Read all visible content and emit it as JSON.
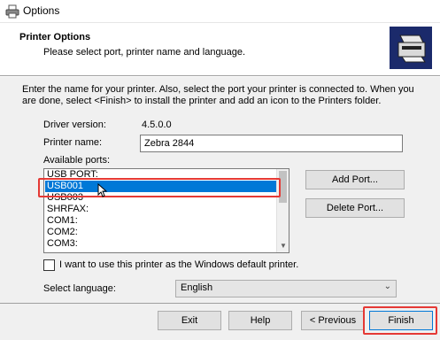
{
  "window": {
    "title": "Options"
  },
  "header": {
    "title": "Printer Options",
    "subtitle": "Please select port, printer name and language."
  },
  "body": {
    "intro": "Enter the name for your printer. Also, select the port your printer is connected to. When you are done, select <Finish> to install the printer and add an icon to the Printers folder.",
    "driver_label": "Driver version:",
    "driver_value": "4.5.0.0",
    "name_label": "Printer name:",
    "name_value": "Zebra 2844",
    "ports_label": "Available ports:",
    "ports": [
      "USB PORT:",
      "USB001",
      "USB003",
      "SHRFAX:",
      "COM1:",
      "COM2:",
      "COM3:"
    ],
    "selected_port": "USB001",
    "add_port": "Add Port...",
    "delete_port": "Delete Port...",
    "default_check_label": "I want to use this printer as the Windows default printer.",
    "default_checked": false,
    "language_label": "Select language:",
    "language_value": "English"
  },
  "footer": {
    "exit": "Exit",
    "help": "Help",
    "previous": "< Previous",
    "finish": "Finish"
  },
  "colors": {
    "selection": "#0078d7",
    "highlight": "#e53935"
  },
  "icons": [
    "printer-app-icon",
    "printer-header-graphic",
    "mouse-cursor-icon",
    "scroll-down-arrow",
    "chevron-down-icon"
  ]
}
